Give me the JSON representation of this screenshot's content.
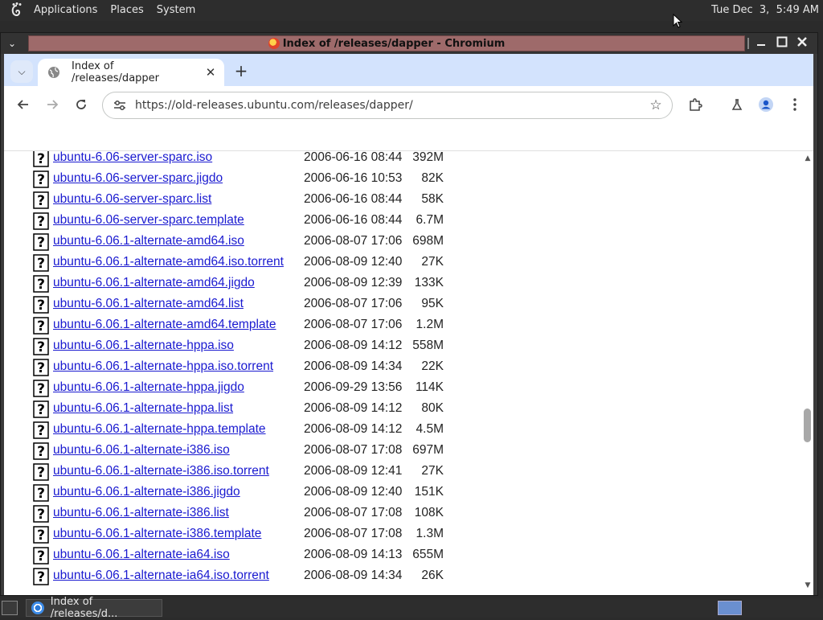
{
  "top_panel": {
    "menus": [
      "Applications",
      "Places",
      "System"
    ],
    "clock": "Tue Dec  3,  5:49 AM"
  },
  "window": {
    "title": "Index of /releases/dapper - Chromium"
  },
  "browser": {
    "tab_title": "Index of /releases/dapper",
    "url": "https://old-releases.ubuntu.com/releases/dapper/"
  },
  "listing": [
    {
      "name": "ubuntu-6.06-server-sparc.iso",
      "date": "2006-06-16 08:44",
      "size": "392M"
    },
    {
      "name": "ubuntu-6.06-server-sparc.jigdo",
      "date": "2006-06-16 10:53",
      "size": "82K"
    },
    {
      "name": "ubuntu-6.06-server-sparc.list",
      "date": "2006-06-16 08:44",
      "size": "58K"
    },
    {
      "name": "ubuntu-6.06-server-sparc.template",
      "date": "2006-06-16 08:44",
      "size": "6.7M"
    },
    {
      "name": "ubuntu-6.06.1-alternate-amd64.iso",
      "date": "2006-08-07 17:06",
      "size": "698M"
    },
    {
      "name": "ubuntu-6.06.1-alternate-amd64.iso.torrent",
      "date": "2006-08-09 12:40",
      "size": "27K"
    },
    {
      "name": "ubuntu-6.06.1-alternate-amd64.jigdo",
      "date": "2006-08-09 12:39",
      "size": "133K"
    },
    {
      "name": "ubuntu-6.06.1-alternate-amd64.list",
      "date": "2006-08-07 17:06",
      "size": "95K"
    },
    {
      "name": "ubuntu-6.06.1-alternate-amd64.template",
      "date": "2006-08-07 17:06",
      "size": "1.2M"
    },
    {
      "name": "ubuntu-6.06.1-alternate-hppa.iso",
      "date": "2006-08-09 14:12",
      "size": "558M"
    },
    {
      "name": "ubuntu-6.06.1-alternate-hppa.iso.torrent",
      "date": "2006-08-09 14:34",
      "size": "22K"
    },
    {
      "name": "ubuntu-6.06.1-alternate-hppa.jigdo",
      "date": "2006-09-29 13:56",
      "size": "114K"
    },
    {
      "name": "ubuntu-6.06.1-alternate-hppa.list",
      "date": "2006-08-09 14:12",
      "size": "80K"
    },
    {
      "name": "ubuntu-6.06.1-alternate-hppa.template",
      "date": "2006-08-09 14:12",
      "size": "4.5M"
    },
    {
      "name": "ubuntu-6.06.1-alternate-i386.iso",
      "date": "2006-08-07 17:08",
      "size": "697M"
    },
    {
      "name": "ubuntu-6.06.1-alternate-i386.iso.torrent",
      "date": "2006-08-09 12:41",
      "size": "27K"
    },
    {
      "name": "ubuntu-6.06.1-alternate-i386.jigdo",
      "date": "2006-08-09 12:40",
      "size": "151K"
    },
    {
      "name": "ubuntu-6.06.1-alternate-i386.list",
      "date": "2006-08-07 17:08",
      "size": "108K"
    },
    {
      "name": "ubuntu-6.06.1-alternate-i386.template",
      "date": "2006-08-07 17:08",
      "size": "1.3M"
    },
    {
      "name": "ubuntu-6.06.1-alternate-ia64.iso",
      "date": "2006-08-09 14:13",
      "size": "655M"
    },
    {
      "name": "ubuntu-6.06.1-alternate-ia64.iso.torrent",
      "date": "2006-08-09 14:34",
      "size": "26K"
    }
  ],
  "taskbar": {
    "task_label": "Index of /releases/d..."
  }
}
